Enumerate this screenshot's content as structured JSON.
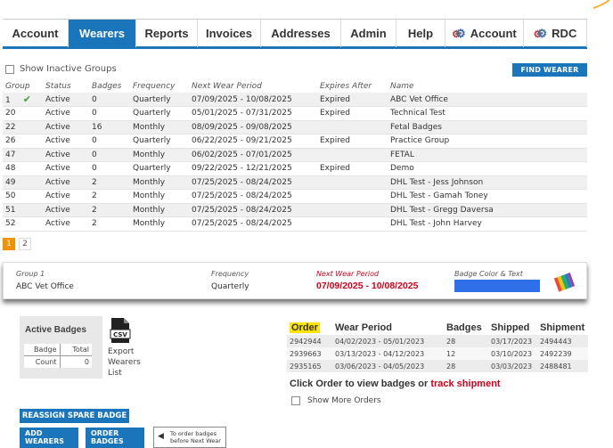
{
  "nav": {
    "tabs": [
      {
        "label": "Account",
        "active": false,
        "icon": ""
      },
      {
        "label": "Wearers",
        "active": true,
        "icon": ""
      },
      {
        "label": "Reports",
        "active": false,
        "icon": ""
      },
      {
        "label": "Invoices",
        "active": false,
        "icon": ""
      },
      {
        "label": "Addresses",
        "active": false,
        "icon": ""
      },
      {
        "label": "Admin",
        "active": false,
        "icon": ""
      },
      {
        "label": "Help",
        "active": false,
        "icon": ""
      },
      {
        "label": "Account",
        "active": false,
        "icon": "gears-icon"
      },
      {
        "label": "RDC",
        "active": false,
        "icon": "gears-icon"
      }
    ],
    "accent": "#1a75bb"
  },
  "groups_section": {
    "show_inactive_label": "Show Inactive Groups",
    "find_wearer_label": "FIND WEARER",
    "headers": [
      "Group",
      "Status",
      "Badges",
      "Frequency",
      "Next Wear Period",
      "Expires After",
      "Name"
    ],
    "rows": [
      {
        "group": "1",
        "selected": true,
        "status": "Active",
        "badges": "0",
        "frequency": "Quarterly",
        "period": "07/09/2025 - 10/08/2025",
        "expires": "Expired",
        "name": "ABC Vet Office"
      },
      {
        "group": "20",
        "selected": false,
        "status": "Active",
        "badges": "0",
        "frequency": "Quarterly",
        "period": "05/01/2025 - 07/31/2025",
        "expires": "Expired",
        "name": "Technical Test"
      },
      {
        "group": "22",
        "selected": false,
        "status": "Active",
        "badges": "16",
        "frequency": "Monthly",
        "period": "08/09/2025 - 09/08/2025",
        "expires": "",
        "name": "Fetal Badges"
      },
      {
        "group": "26",
        "selected": false,
        "status": "Active",
        "badges": "0",
        "frequency": "Quarterly",
        "period": "06/22/2025 - 09/21/2025",
        "expires": "Expired",
        "name": "Practice Group"
      },
      {
        "group": "47",
        "selected": false,
        "status": "Active",
        "badges": "0",
        "frequency": "Monthly",
        "period": "06/02/2025 - 07/01/2025",
        "expires": "",
        "name": "FETAL"
      },
      {
        "group": "48",
        "selected": false,
        "status": "Active",
        "badges": "0",
        "frequency": "Quarterly",
        "period": "09/22/2025 - 12/21/2025",
        "expires": "Expired",
        "name": "Demo"
      },
      {
        "group": "49",
        "selected": false,
        "status": "Active",
        "badges": "2",
        "frequency": "Monthly",
        "period": "07/25/2025 - 08/24/2025",
        "expires": "",
        "name": "DHL Test - Jess Johnson"
      },
      {
        "group": "50",
        "selected": false,
        "status": "Active",
        "badges": "2",
        "frequency": "Monthly",
        "period": "07/25/2025 - 08/24/2025",
        "expires": "",
        "name": "DHL Test - Gamah Toney"
      },
      {
        "group": "51",
        "selected": false,
        "status": "Active",
        "badges": "2",
        "frequency": "Monthly",
        "period": "07/25/2025 - 08/24/2025",
        "expires": "",
        "name": "DHL Test - Gregg Daversa"
      },
      {
        "group": "52",
        "selected": false,
        "status": "Active",
        "badges": "2",
        "frequency": "Monthly",
        "period": "07/25/2025 - 08/24/2025",
        "expires": "",
        "name": "DHL Test - John Harvey"
      }
    ],
    "pages": [
      "1",
      "2"
    ],
    "current_page": "1",
    "page_accent": "#f39200"
  },
  "detail": {
    "group_label": "Group 1",
    "group_name": "ABC Vet Office",
    "frequency_label": "Frequency",
    "frequency_value": "Quarterly",
    "period_label": "Next Wear Period",
    "period_value": "07/09/2025 - 10/08/2025",
    "badge_color_label": "Badge Color & Text",
    "badge_color": "#2f6fe8",
    "period_color": "#d0021b"
  },
  "active_badges": {
    "title": "Active Badges",
    "col_badge": "Badge",
    "col_total": "Total",
    "row_label": "Count",
    "row_value": "0"
  },
  "export": {
    "csv_label": "CSV",
    "label_lines": [
      "Export",
      "Wearers",
      "List"
    ]
  },
  "orders": {
    "headers": [
      "Order",
      "Wear Period",
      "Badges",
      "Shipped",
      "Shipment"
    ],
    "rows": [
      {
        "order": "2942944",
        "period": "04/02/2023 - 05/01/2023",
        "badges": "28",
        "shipped": "03/17/2023",
        "shipment": "2494443"
      },
      {
        "order": "2939663",
        "period": "03/13/2023 - 04/12/2023",
        "badges": "12",
        "shipped": "03/10/2023",
        "shipment": "2492239"
      },
      {
        "order": "2935165",
        "period": "03/06/2023 - 04/05/2023",
        "badges": "28",
        "shipped": "03/03/2023",
        "shipment": "2488481"
      }
    ],
    "click_text": "Click Order to view badges or ",
    "track_text": "track shipment",
    "show_more_label": "Show More Orders"
  },
  "buttons": {
    "reassign": "REASSIGN SPARE BADGE",
    "add_wearers": [
      "ADD",
      "WEARERS"
    ],
    "order_badges": [
      "ORDER",
      "BADGES"
    ],
    "tooltip": [
      "To order badges",
      "before Next Wear"
    ]
  }
}
